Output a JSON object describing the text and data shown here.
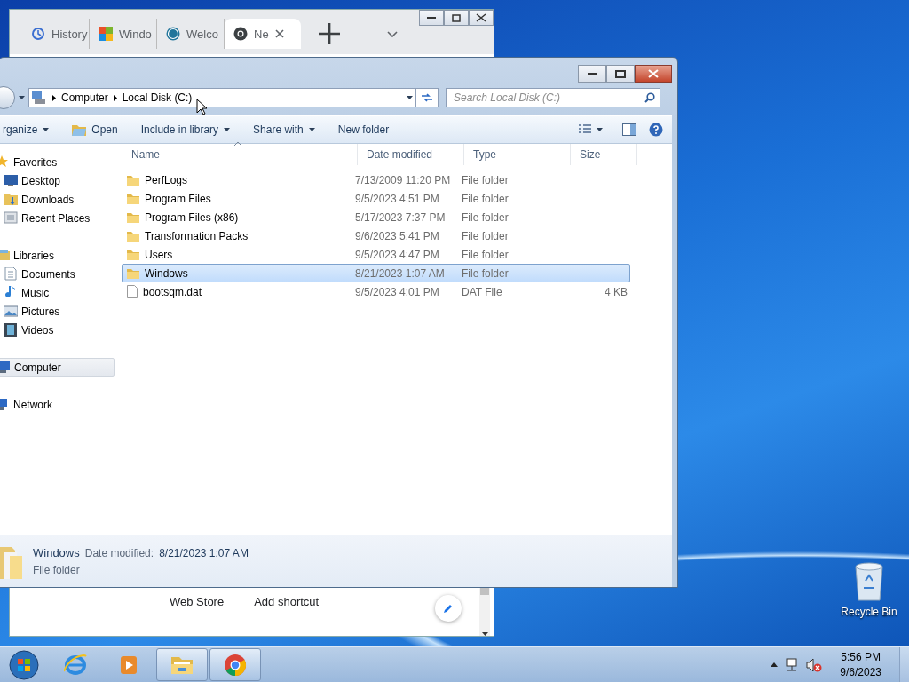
{
  "browser": {
    "tabs": [
      {
        "title": "History",
        "selected": false
      },
      {
        "title": "Windo",
        "selected": false
      },
      {
        "title": "Welco",
        "selected": false
      },
      {
        "title": "Ne",
        "selected": true
      }
    ],
    "shortcuts": [
      "Web Store",
      "Add shortcut"
    ]
  },
  "explorer": {
    "breadcrumb": [
      "Computer",
      "Local Disk (C:)"
    ],
    "search": {
      "placeholder": "Search Local Disk (C:)"
    },
    "toolbar": [
      {
        "label": "rganize",
        "has_menu": true
      },
      {
        "label": "Open",
        "has_menu": false
      },
      {
        "label": "Include in library",
        "has_menu": true
      },
      {
        "label": "Share with",
        "has_menu": true
      },
      {
        "label": "New folder",
        "has_menu": false
      }
    ],
    "nav": [
      {
        "label": "Favorites",
        "selected": false,
        "children": [
          {
            "label": "Desktop",
            "selected": false
          },
          {
            "label": "Downloads",
            "selected": false
          },
          {
            "label": "Recent Places",
            "selected": false
          }
        ]
      },
      {
        "label": "Libraries",
        "selected": false,
        "children": [
          {
            "label": "Documents",
            "selected": false
          },
          {
            "label": "Music",
            "selected": false
          },
          {
            "label": "Pictures",
            "selected": false
          },
          {
            "label": "Videos",
            "selected": false
          }
        ]
      },
      {
        "label": "Computer",
        "selected": true
      },
      {
        "label": "Network",
        "selected": false
      }
    ],
    "columns": [
      "Name",
      "Date modified",
      "Type",
      "Size"
    ],
    "rows": [
      {
        "kind": "folder",
        "name": "PerfLogs",
        "date": "7/13/2009 11:20 PM",
        "type": "File folder",
        "selected": false
      },
      {
        "kind": "folder",
        "name": "Program Files",
        "date": "9/5/2023 4:51 PM",
        "type": "File folder",
        "selected": false
      },
      {
        "kind": "folder",
        "name": "Program Files (x86)",
        "date": "5/17/2023 7:37 PM",
        "type": "File folder",
        "selected": false
      },
      {
        "kind": "folder",
        "name": "Transformation Packs",
        "date": "9/6/2023 5:41 PM",
        "type": "File folder",
        "selected": false
      },
      {
        "kind": "folder",
        "name": "Users",
        "date": "9/5/2023 4:47 PM",
        "type": "File folder",
        "selected": false
      },
      {
        "kind": "folder",
        "name": "Windows",
        "date": "8/21/2023 1:07 AM",
        "type": "File folder",
        "selected": true
      },
      {
        "kind": "file",
        "name": "bootsqm.dat",
        "date": "9/5/2023 4:01 PM",
        "type": "DAT File",
        "size": "4 KB",
        "selected": false
      }
    ],
    "details": {
      "name": "Windows",
      "date_label": "Date modified:",
      "date": "8/21/2023 1:07 AM",
      "type": "File folder"
    }
  },
  "desktop_icons": [
    {
      "label": "Recycle Bin"
    }
  ],
  "taskbar": {
    "apps": [
      {
        "running": false
      },
      {
        "running": false
      },
      {
        "running": true
      },
      {
        "running": true
      }
    ],
    "clock": {
      "time": "5:56 PM",
      "date": "9/6/2023"
    }
  }
}
